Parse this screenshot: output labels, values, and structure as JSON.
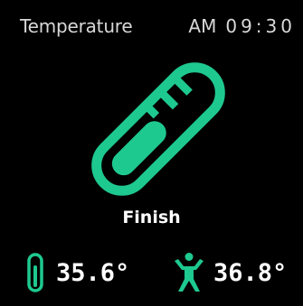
{
  "header": {
    "title": "Temperature",
    "ampm": "AM",
    "time": "09:30"
  },
  "main": {
    "status": "Finish",
    "icon": "thermometer-measuring-icon"
  },
  "readings": {
    "ambient": {
      "icon": "thermometer-icon",
      "value": "35.6°"
    },
    "body": {
      "icon": "person-icon",
      "value": "36.8°"
    }
  },
  "colors": {
    "accent": "#1ec98f",
    "background": "#000000",
    "text": "#ffffff",
    "header_text": "#d8d8d8"
  }
}
